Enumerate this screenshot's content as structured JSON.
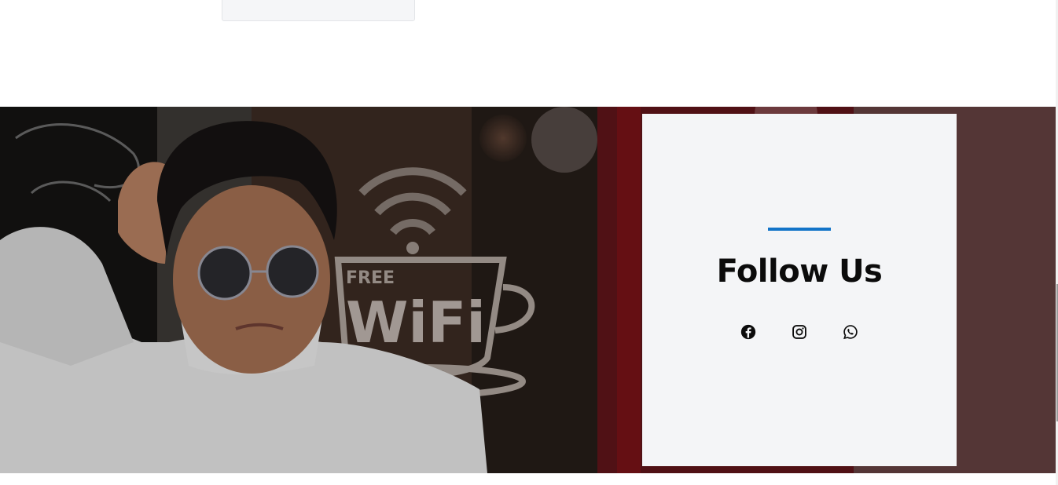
{
  "follow": {
    "title": "Follow Us",
    "accent_color": "#1274c8",
    "icons": [
      "facebook-icon",
      "instagram-icon",
      "whatsapp-icon"
    ]
  },
  "hero": {
    "signs": {
      "wifi_free": "FREE",
      "wifi_text": "WiFi"
    },
    "panel_color": "#543636"
  }
}
